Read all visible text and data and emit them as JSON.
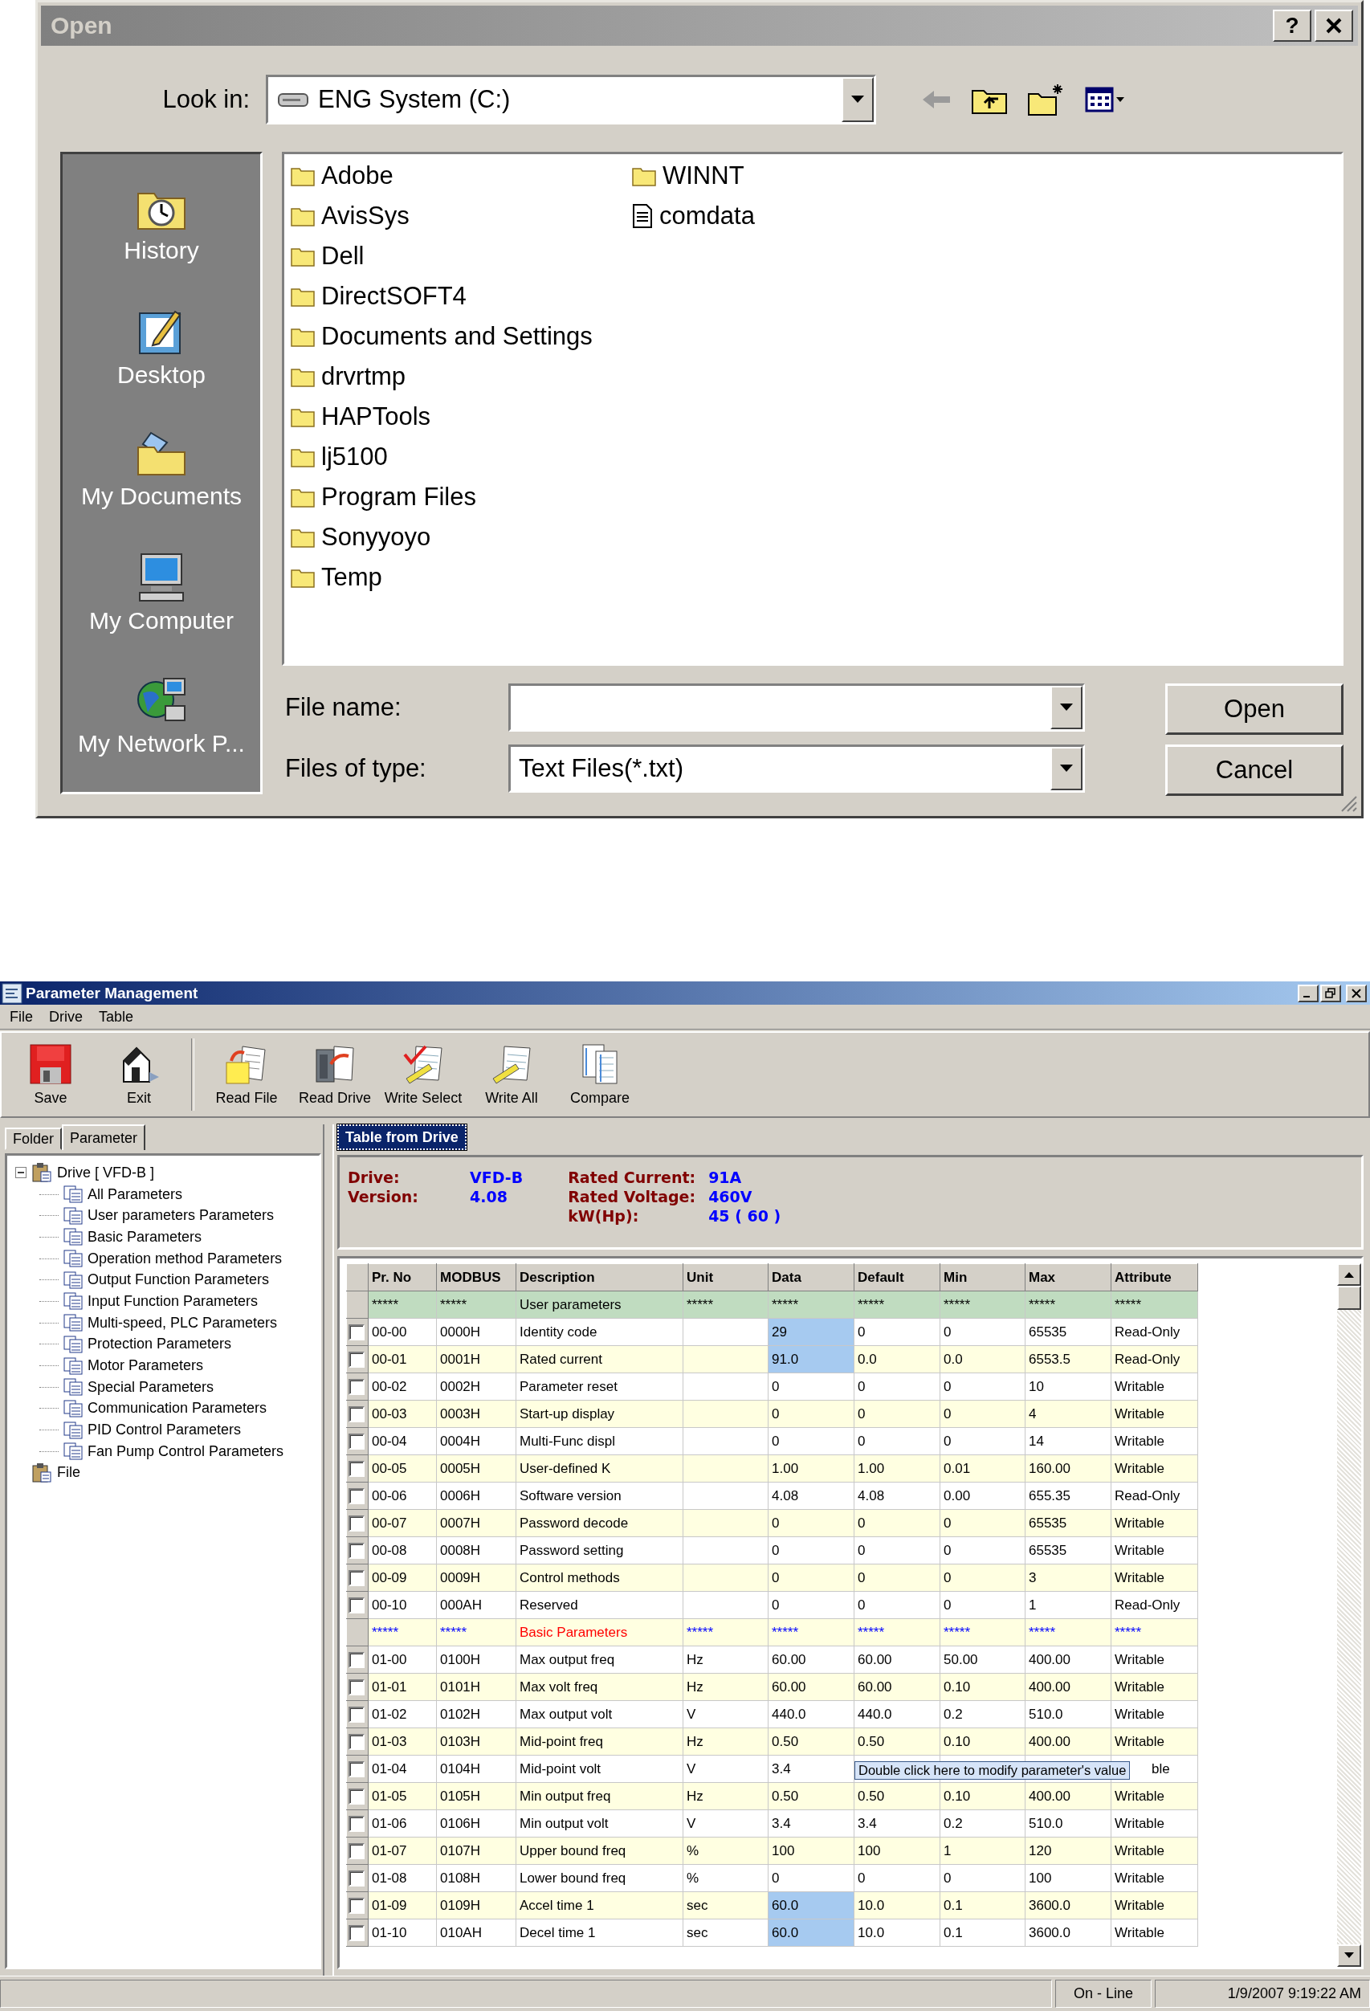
{
  "open_dialog": {
    "title": "Open",
    "help_button": "?",
    "look_in": {
      "label": "Look in:",
      "value": "ENG System (C:)"
    },
    "places": [
      {
        "label": "History",
        "kind": "history"
      },
      {
        "label": "Desktop",
        "kind": "desktop"
      },
      {
        "label": "My Documents",
        "kind": "documents"
      },
      {
        "label": "My Computer",
        "kind": "computer"
      },
      {
        "label": "My Network P...",
        "kind": "network"
      }
    ],
    "files": [
      {
        "name": "Adobe",
        "kind": "folder"
      },
      {
        "name": "AvisSys",
        "kind": "folder"
      },
      {
        "name": "Dell",
        "kind": "folder"
      },
      {
        "name": "DirectSOFT4",
        "kind": "folder"
      },
      {
        "name": "Documents and Settings",
        "kind": "folder"
      },
      {
        "name": "drvrtmp",
        "kind": "folder"
      },
      {
        "name": "HAPTools",
        "kind": "folder"
      },
      {
        "name": "lj5100",
        "kind": "folder"
      },
      {
        "name": "Program Files",
        "kind": "folder"
      },
      {
        "name": "Sonyyoyo",
        "kind": "folder"
      },
      {
        "name": "Temp",
        "kind": "folder"
      },
      {
        "name": "WINNT",
        "kind": "folder"
      },
      {
        "name": "comdata",
        "kind": "document"
      }
    ],
    "file_name": {
      "label": "File name:"
    },
    "files_of_type": {
      "label": "Files of type:",
      "value": "Text Files(*.txt)"
    },
    "buttons": [
      "Open",
      "Cancel"
    ]
  },
  "parameter_window": {
    "title": "Parameter Management",
    "menu": [
      "File",
      "Drive",
      "Table"
    ],
    "toolbar_groups": [
      [
        {
          "label": "Save",
          "kind": "save"
        },
        {
          "label": "Exit",
          "kind": "exit"
        }
      ],
      [
        {
          "label": "Read File",
          "kind": "read_file"
        },
        {
          "label": "Read Drive",
          "kind": "read_drive"
        },
        {
          "label": "Write Select",
          "kind": "write_select"
        },
        {
          "label": "Write All",
          "kind": "write_all"
        },
        {
          "label": "Compare",
          "kind": "compare"
        }
      ]
    ],
    "left_tabs": [
      {
        "label": "Folder",
        "selected": false
      },
      {
        "label": "Parameter",
        "selected": true
      }
    ],
    "tree": [
      {
        "label": "Drive [ VFD-B ]",
        "expanded": true,
        "children": [
          {
            "label": "All Parameters"
          },
          {
            "label": "User parameters Parameters"
          },
          {
            "label": "Basic Parameters"
          },
          {
            "label": "Operation method Parameters"
          },
          {
            "label": "Output Function Parameters"
          },
          {
            "label": "Input Function Parameters"
          },
          {
            "label": "Multi-speed, PLC Parameters"
          },
          {
            "label": "Protection Parameters"
          },
          {
            "label": "Motor Parameters"
          },
          {
            "label": "Special Parameters"
          },
          {
            "label": "Communication Parameters"
          },
          {
            "label": "PID Control Parameters"
          },
          {
            "label": "Fan Pump Control Parameters"
          }
        ]
      },
      {
        "label": "File"
      }
    ],
    "right_tabs": [
      {
        "label": "Table from Drive",
        "selected": true
      }
    ],
    "info_left": [
      {
        "label": "Drive:",
        "value": "VFD-B"
      },
      {
        "label": "Version:",
        "value": "4.08"
      }
    ],
    "info_right": [
      {
        "label": "Rated Current:",
        "value": "91A"
      },
      {
        "label": "Rated Voltage:",
        "value": "460V"
      },
      {
        "label": "kW(Hp):",
        "value": "45 ( 60 )"
      }
    ],
    "table": {
      "columns": [
        "Pr. No",
        "MODBUS",
        "Description",
        "Unit",
        "Data",
        "Default",
        "Min",
        "Max",
        "Attribute"
      ],
      "rows": [
        {
          "kind": "section",
          "color": "#c0dcc0",
          "pr_no": "*****",
          "modbus": "*****",
          "description": "User parameters",
          "unit": "*****",
          "data": "*****",
          "default": "*****",
          "min": "*****",
          "max": "*****",
          "attribute": "*****"
        },
        {
          "kind": "param",
          "checked": false,
          "data_selected": true,
          "pr_no": "00-00",
          "modbus": "0000H",
          "description": "Identity code",
          "data": "29",
          "default": "0",
          "min": "0",
          "max": "65535",
          "attribute": "Read-Only"
        },
        {
          "kind": "param",
          "checked": false,
          "data_selected": true,
          "pr_no": "00-01",
          "modbus": "0001H",
          "description": "Rated current",
          "data": "91.0",
          "default": "0.0",
          "min": "0.0",
          "max": "6553.5",
          "attribute": "Read-Only"
        },
        {
          "kind": "param",
          "checked": false,
          "data_selected": false,
          "pr_no": "00-02",
          "modbus": "0002H",
          "description": "Parameter reset",
          "data": "0",
          "default": "0",
          "min": "0",
          "max": "10",
          "attribute": "Writable"
        },
        {
          "kind": "param",
          "checked": false,
          "data_selected": false,
          "pr_no": "00-03",
          "modbus": "0003H",
          "description": "Start-up display",
          "data": "0",
          "default": "0",
          "min": "0",
          "max": "4",
          "attribute": "Writable"
        },
        {
          "kind": "param",
          "checked": false,
          "data_selected": false,
          "pr_no": "00-04",
          "modbus": "0004H",
          "description": "Multi-Func displ",
          "data": "0",
          "default": "0",
          "min": "0",
          "max": "14",
          "attribute": "Writable"
        },
        {
          "kind": "param",
          "checked": false,
          "data_selected": false,
          "pr_no": "00-05",
          "modbus": "0005H",
          "description": "User-defined K",
          "data": "1.00",
          "default": "1.00",
          "min": "0.01",
          "max": "160.00",
          "attribute": "Writable"
        },
        {
          "kind": "param",
          "checked": false,
          "data_selected": false,
          "pr_no": "00-06",
          "modbus": "0006H",
          "description": "Software version",
          "data": "4.08",
          "default": "4.08",
          "min": "0.00",
          "max": "655.35",
          "attribute": "Read-Only"
        },
        {
          "kind": "param",
          "checked": false,
          "data_selected": false,
          "pr_no": "00-07",
          "modbus": "0007H",
          "description": "Password decode",
          "data": "0",
          "default": "0",
          "min": "0",
          "max": "65535",
          "attribute": "Writable"
        },
        {
          "kind": "param",
          "checked": false,
          "data_selected": false,
          "pr_no": "00-08",
          "modbus": "0008H",
          "description": "Password setting",
          "data": "0",
          "default": "0",
          "min": "0",
          "max": "65535",
          "attribute": "Writable"
        },
        {
          "kind": "param",
          "checked": false,
          "data_selected": false,
          "pr_no": "00-09",
          "modbus": "0009H",
          "description": "Control methods",
          "data": "0",
          "default": "0",
          "min": "0",
          "max": "3",
          "attribute": "Writable"
        },
        {
          "kind": "param",
          "checked": false,
          "data_selected": false,
          "pr_no": "00-10",
          "modbus": "000AH",
          "description": "Reserved",
          "data": "0",
          "default": "0",
          "min": "0",
          "max": "1",
          "attribute": "Read-Only"
        },
        {
          "kind": "colored_section",
          "color": "#ffffe1",
          "pr_no": "*****",
          "modbus": "*****",
          "description": "Basic Parameters",
          "unit": "*****",
          "data": "*****",
          "default": "*****",
          "min": "*****",
          "max": "*****",
          "attribute": "*****"
        },
        {
          "kind": "param",
          "checked": false,
          "data_selected": false,
          "pr_no": "01-00",
          "modbus": "0100H",
          "description": "Max output freq",
          "unit": "Hz",
          "data": "60.00",
          "default": "60.00",
          "min": "50.00",
          "max": "400.00",
          "attribute": "Writable"
        },
        {
          "kind": "param",
          "checked": false,
          "data_selected": false,
          "pr_no": "01-01",
          "modbus": "0101H",
          "description": "Max volt freq",
          "unit": "Hz",
          "data": "60.00",
          "default": "60.00",
          "min": "0.10",
          "max": "400.00",
          "attribute": "Writable"
        },
        {
          "kind": "param",
          "checked": false,
          "data_selected": false,
          "pr_no": "01-02",
          "modbus": "0102H",
          "description": "Max output volt",
          "unit": "V",
          "data": "440.0",
          "default": "440.0",
          "min": "0.2",
          "max": "510.0",
          "attribute": "Writable"
        },
        {
          "kind": "param",
          "checked": false,
          "data_selected": false,
          "pr_no": "01-03",
          "modbus": "0103H",
          "description": "Mid-point freq",
          "unit": "Hz",
          "data": "0.50",
          "default": "0.50",
          "min": "0.10",
          "max": "400.00",
          "attribute": "Writable"
        },
        {
          "kind": "param",
          "checked": false,
          "data_selected": false,
          "pr_no": "01-04",
          "modbus": "0104H",
          "description": "Mid-point volt",
          "unit": "V",
          "data": "3.4",
          "attribute": "ble",
          "tooltip": "Double click here to modify parameter's value"
        },
        {
          "kind": "param",
          "checked": false,
          "data_selected": false,
          "pr_no": "01-05",
          "modbus": "0105H",
          "description": "Min output freq",
          "unit": "Hz",
          "data": "0.50",
          "default": "0.50",
          "min": "0.10",
          "max": "400.00",
          "attribute": "Writable"
        },
        {
          "kind": "param",
          "checked": false,
          "data_selected": false,
          "pr_no": "01-06",
          "modbus": "0106H",
          "description": "Min output volt",
          "unit": "V",
          "data": "3.4",
          "default": "3.4",
          "min": "0.2",
          "max": "510.0",
          "attribute": "Writable"
        },
        {
          "kind": "param",
          "checked": false,
          "data_selected": false,
          "pr_no": "01-07",
          "modbus": "0107H",
          "description": "Upper bound freq",
          "unit": "%",
          "data": "100",
          "default": "100",
          "min": "1",
          "max": "120",
          "attribute": "Writable"
        },
        {
          "kind": "param",
          "checked": false,
          "data_selected": false,
          "pr_no": "01-08",
          "modbus": "0108H",
          "description": "Lower bound freq",
          "unit": "%",
          "data": "0",
          "default": "0",
          "min": "0",
          "max": "100",
          "attribute": "Writable"
        },
        {
          "kind": "param",
          "checked": false,
          "data_selected": true,
          "pr_no": "01-09",
          "modbus": "0109H",
          "description": "Accel time 1",
          "unit": "sec",
          "data": "60.0",
          "default": "10.0",
          "min": "0.1",
          "max": "3600.0",
          "attribute": "Writable"
        },
        {
          "kind": "param",
          "checked": false,
          "data_selected": true,
          "pr_no": "01-10",
          "modbus": "010AH",
          "description": "Decel time 1",
          "unit": "sec",
          "data": "60.0",
          "default": "10.0",
          "min": "0.1",
          "max": "3600.0",
          "attribute": "Writable"
        }
      ]
    },
    "status_bar": [
      "On - Line",
      "1/9/2007 9:19:22 AM"
    ]
  }
}
